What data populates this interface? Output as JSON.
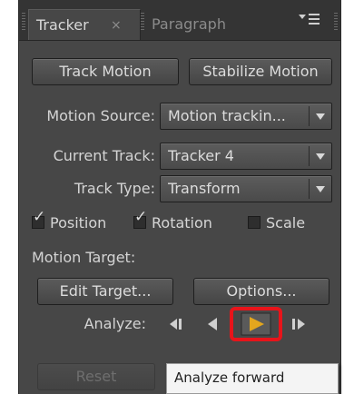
{
  "tabs": {
    "active": "Tracker",
    "inactive": "Paragraph",
    "close_glyph": "×",
    "menu_icon": "panel-menu-icon"
  },
  "buttons": {
    "track_motion": "Track Motion",
    "stabilize_motion": "Stabilize Motion",
    "edit_target": "Edit Target...",
    "options": "Options...",
    "reset": "Reset"
  },
  "fields": {
    "motion_source": {
      "label": "Motion Source:",
      "value": "Motion trackin..."
    },
    "current_track": {
      "label": "Current Track:",
      "value": "Tracker 4"
    },
    "track_type": {
      "label": "Track Type:",
      "value": "Transform"
    }
  },
  "checkboxes": [
    {
      "label": "Position",
      "checked": true
    },
    {
      "label": "Rotation",
      "checked": true
    },
    {
      "label": "Scale",
      "checked": false
    }
  ],
  "motion_target_label": "Motion Target:",
  "analyze": {
    "label": "Analyze:",
    "controls": [
      "analyze-one-frame-back-icon",
      "analyze-backward-icon",
      "analyze-forward-icon",
      "analyze-one-frame-forward-icon"
    ]
  },
  "tooltip": "Analyze forward",
  "colors": {
    "panel_bg": "#474747",
    "highlight_red": "#e8141a",
    "play_orange": "#e3a61e"
  }
}
